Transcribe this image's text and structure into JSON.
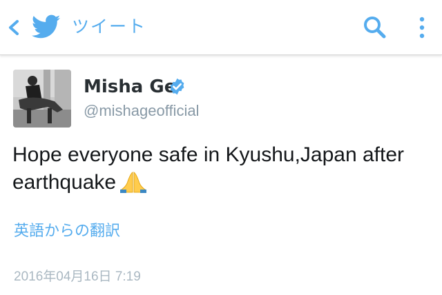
{
  "header": {
    "title": "ツイート",
    "back_icon": "chevron-left-icon",
    "logo_icon": "twitter-bird-icon",
    "search_icon": "search-icon",
    "more_icon": "more-vertical-icon",
    "accent_color": "#55acee"
  },
  "tweet": {
    "display_name": "Misha Ge",
    "verified": true,
    "handle": "@mishageofficial",
    "text": "Hope everyone safe in Kyushu,Japan after earthquake",
    "emoji": "folded-hands-emoji",
    "translate_label": "英語からの翻訳",
    "timestamp": "2016年04月16日 7:19"
  }
}
